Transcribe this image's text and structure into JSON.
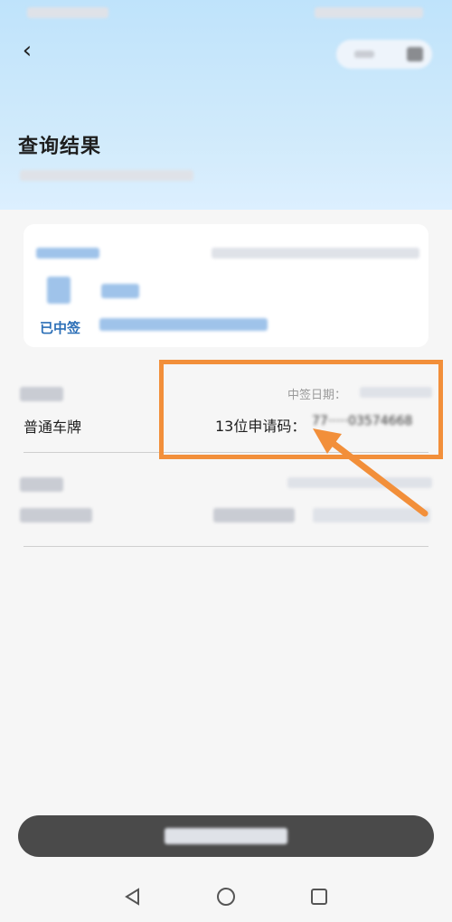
{
  "header": {
    "back_icon": "chevron-left-icon",
    "back_glyph": "‹",
    "title": "查询结果"
  },
  "summary_card": {
    "status": "已中签"
  },
  "result_row": {
    "plate_type": "普通车牌",
    "date_label": "中签日期：",
    "code_label": "13位申请码：",
    "code_value_partial": "77·····03574668"
  },
  "colors": {
    "accent_blue": "#2c6fb7",
    "highlight_orange": "#f28f3a",
    "header_bg": "#c6e6fb"
  }
}
